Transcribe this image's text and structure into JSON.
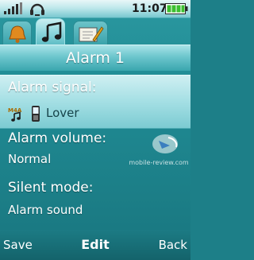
{
  "status": {
    "time": "11:07",
    "signal_icon": "signal-bars-icon",
    "headset_icon": "headset-icon",
    "battery_icon": "battery-icon"
  },
  "tabs": [
    {
      "name": "bell-icon",
      "active": false
    },
    {
      "name": "music-note-icon",
      "active": true
    },
    {
      "name": "pencil-icon",
      "active": false
    }
  ],
  "title": "Alarm 1",
  "settings": [
    {
      "label": "Alarm signal:",
      "value": "Lover",
      "selected": true,
      "icons": [
        "m4a-file-icon",
        "phone-memory-icon"
      ]
    },
    {
      "label": "Alarm volume:",
      "value": "Normal",
      "selected": false
    },
    {
      "label": "Silent mode:",
      "value": "Alarm sound",
      "selected": false
    }
  ],
  "watermark": {
    "text": "mobile-review.com",
    "icon": "watermark-logo-icon"
  },
  "softkeys": {
    "left": "Save",
    "center": "Edit",
    "right": "Back"
  },
  "colors": {
    "background": "#1f8891",
    "highlight": "#a4dfe4",
    "statusbar": "#bfe8eb"
  }
}
